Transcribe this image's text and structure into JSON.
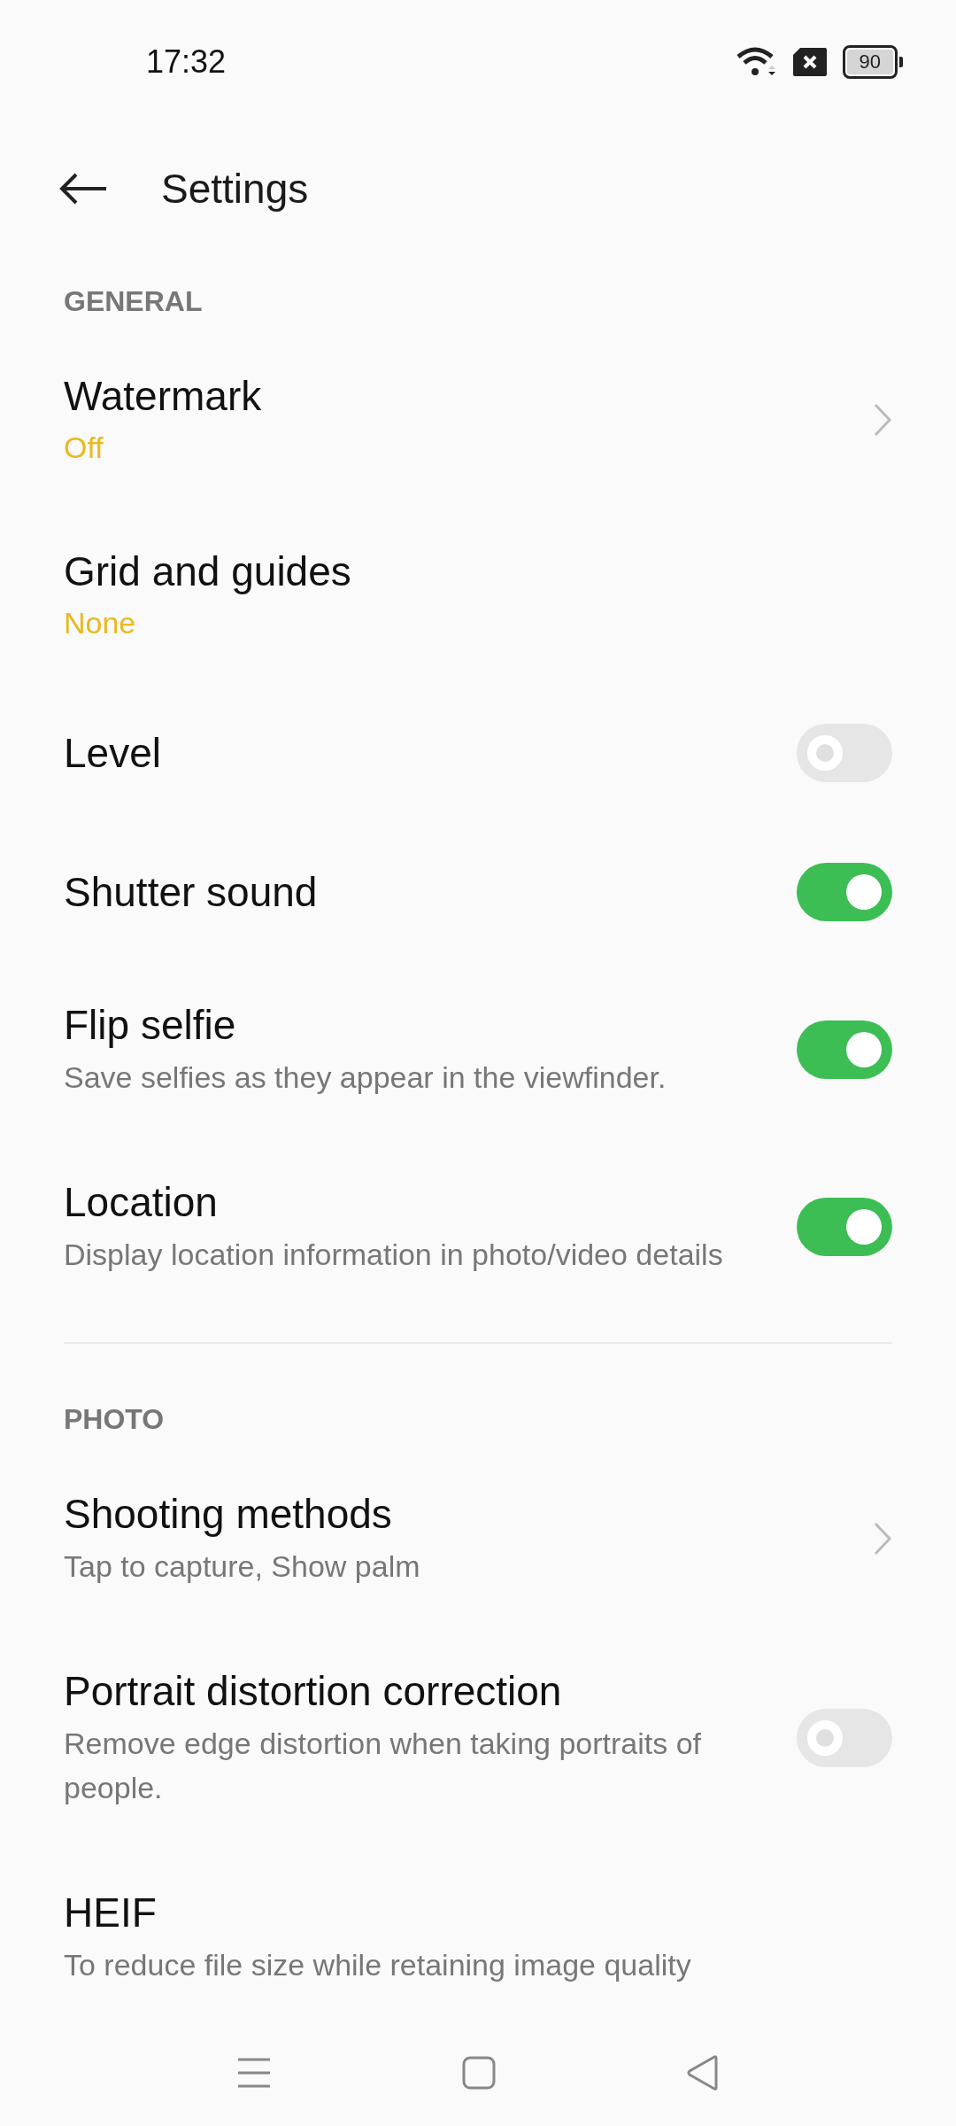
{
  "status_bar": {
    "time": "17:32",
    "battery": "90"
  },
  "header": {
    "title": "Settings"
  },
  "sections": [
    {
      "title": "GENERAL",
      "items": [
        {
          "kind": "chevron",
          "title": "Watermark",
          "value": "Off"
        },
        {
          "kind": "plain",
          "title": "Grid and guides",
          "value": "None"
        },
        {
          "kind": "toggle",
          "title": "Level",
          "on": false
        },
        {
          "kind": "toggle",
          "title": "Shutter sound",
          "on": true
        },
        {
          "kind": "toggle",
          "title": "Flip selfie",
          "description": "Save selfies as they appear in the viewfinder.",
          "on": true
        },
        {
          "kind": "toggle",
          "title": "Location",
          "description": "Display location information in photo/video details",
          "on": true
        }
      ]
    },
    {
      "title": "PHOTO",
      "items": [
        {
          "kind": "chevron",
          "title": "Shooting methods",
          "description": "Tap to capture, Show palm"
        },
        {
          "kind": "toggle",
          "title": "Portrait distortion correction",
          "description": "Remove edge distortion when taking portraits of people.",
          "on": false
        },
        {
          "kind": "plain",
          "title": "HEIF",
          "description": "To reduce file size while retaining image quality"
        }
      ]
    }
  ]
}
